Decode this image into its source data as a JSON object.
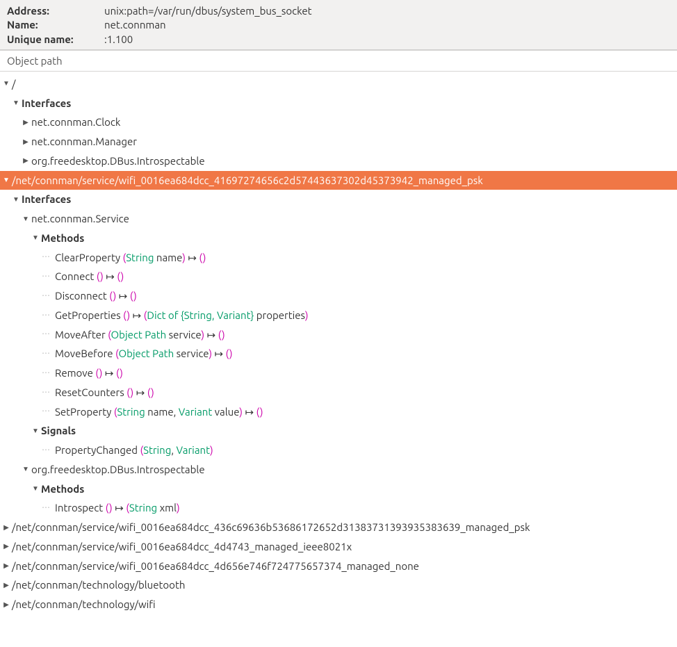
{
  "header": {
    "address_label": "Address:",
    "address_value": "unix:path=/var/run/dbus/system_bus_socket",
    "name_label": "Name:",
    "name_value": "net.connman",
    "unique_label": "Unique name:",
    "unique_value": ":1.100"
  },
  "column_header": "Object path",
  "tree": {
    "root": "/",
    "interfaces_label": "Interfaces",
    "root_interfaces": [
      "net.connman.Clock",
      "net.connman.Manager",
      "org.freedesktop.DBus.Introspectable"
    ],
    "selected_path": "/net/connman/service/wifi_0016ea684dcc_41697274656c2d57443637302d45373942_managed_psk",
    "service_iface": "net.connman.Service",
    "methods_label": "Methods",
    "signals_label": "Signals",
    "methods": {
      "clearproperty": {
        "name": "ClearProperty",
        "args_open": "(",
        "type1": "String",
        "arg1": " name",
        "args_close": ")",
        "ret": "()"
      },
      "connect": {
        "name": "Connect",
        "args": "()",
        "ret": "()"
      },
      "disconnect": {
        "name": "Disconnect",
        "args": "()",
        "ret": "()"
      },
      "getproperties": {
        "name": "GetProperties",
        "args": "()",
        "ret_open": "(",
        "ret_type": "Dict of {String, Variant}",
        "ret_arg": " properties",
        "ret_close": ")"
      },
      "moveafter": {
        "name": "MoveAfter",
        "args_open": "(",
        "type1": "Object Path",
        "arg1": " service",
        "args_close": ")",
        "ret": "()"
      },
      "movebefore": {
        "name": "MoveBefore",
        "args_open": "(",
        "type1": "Object Path",
        "arg1": " service",
        "args_close": ")",
        "ret": "()"
      },
      "remove": {
        "name": "Remove",
        "args": "()",
        "ret": "()"
      },
      "resetcounters": {
        "name": "ResetCounters",
        "args": "()",
        "ret": "()"
      },
      "setproperty": {
        "name": "SetProperty",
        "args_open": "(",
        "type1": "String",
        "arg1": " name",
        "sep": ", ",
        "type2": "Variant",
        "arg2": " value",
        "args_close": ")",
        "ret": "()"
      }
    },
    "signal": {
      "name": "PropertyChanged",
      "args_open": "(",
      "type1": "String",
      "sep": ", ",
      "type2": "Variant",
      "args_close": ")"
    },
    "introspectable": "org.freedesktop.DBus.Introspectable",
    "introspect": {
      "name": "Introspect",
      "args": "()",
      "ret_open": "(",
      "ret_type": "String",
      "ret_arg": " xml",
      "ret_close": ")"
    },
    "other_paths": [
      "/net/connman/service/wifi_0016ea684dcc_436c69636b53686172652d31383731393935383639_managed_psk",
      "/net/connman/service/wifi_0016ea684dcc_4d4743_managed_ieee8021x",
      "/net/connman/service/wifi_0016ea684dcc_4d656e746f724775657374_managed_none",
      "/net/connman/technology/bluetooth",
      "/net/connman/technology/wifi"
    ]
  },
  "arrow_symbol": "↦"
}
